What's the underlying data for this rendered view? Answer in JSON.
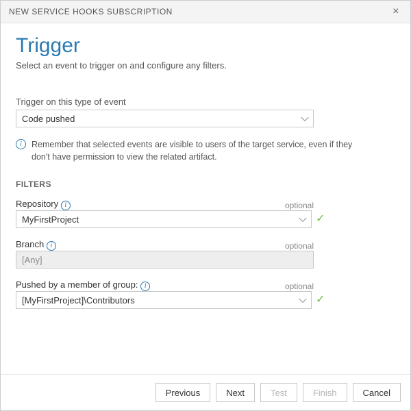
{
  "dialog": {
    "title": "NEW SERVICE HOOKS SUBSCRIPTION",
    "close_symbol": "×"
  },
  "page": {
    "heading": "Trigger",
    "subtitle": "Select an event to trigger on and configure any filters."
  },
  "event": {
    "label": "Trigger on this type of event",
    "value": "Code pushed"
  },
  "callout": {
    "text": "Remember that selected events are visible to users of the target service, even if they don't have permission to view the related artifact."
  },
  "filters": {
    "heading": "FILTERS",
    "optional_label": "optional",
    "repository": {
      "label": "Repository",
      "value": "MyFirstProject"
    },
    "branch": {
      "label": "Branch",
      "value": "[Any]"
    },
    "group": {
      "label": "Pushed by a member of group:",
      "value": "[MyFirstProject]\\Contributors"
    }
  },
  "footer": {
    "previous": "Previous",
    "next": "Next",
    "test": "Test",
    "finish": "Finish",
    "cancel": "Cancel"
  }
}
